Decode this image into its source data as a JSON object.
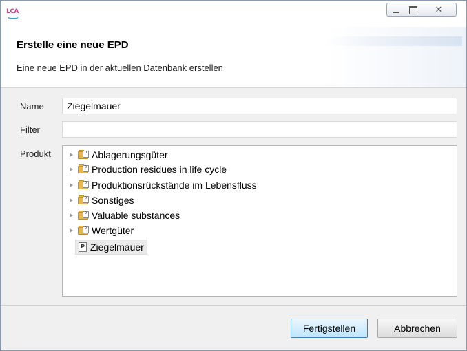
{
  "window": {
    "app_logo_text": "LCA"
  },
  "banner": {
    "title": "Erstelle eine neue EPD",
    "subtitle": "Eine neue EPD in der aktuellen Datenbank erstellen"
  },
  "form": {
    "name_label": "Name",
    "name_value": "Ziegelmauer",
    "filter_label": "Filter",
    "filter_value": "",
    "product_label": "Produkt"
  },
  "tree": {
    "items": [
      {
        "label": "Ablagerungsgüter",
        "type": "folder",
        "expandable": true
      },
      {
        "label": "Production residues in life cycle",
        "type": "folder",
        "expandable": true
      },
      {
        "label": "Produktionsrückstände im Lebensfluss",
        "type": "folder",
        "expandable": true
      },
      {
        "label": "Sonstiges",
        "type": "folder",
        "expandable": true
      },
      {
        "label": "Valuable substances",
        "type": "folder",
        "expandable": true
      },
      {
        "label": "Wertgüter",
        "type": "folder",
        "expandable": true
      },
      {
        "label": "Ziegelmauer",
        "type": "product",
        "expandable": false,
        "selected": true
      }
    ]
  },
  "buttons": {
    "finish_label": "Fertigstellen",
    "cancel_label": "Abbrechen"
  },
  "icons": {
    "close_glyph": "✕",
    "folder_doc_glyph": "P",
    "product_glyph": "P"
  }
}
